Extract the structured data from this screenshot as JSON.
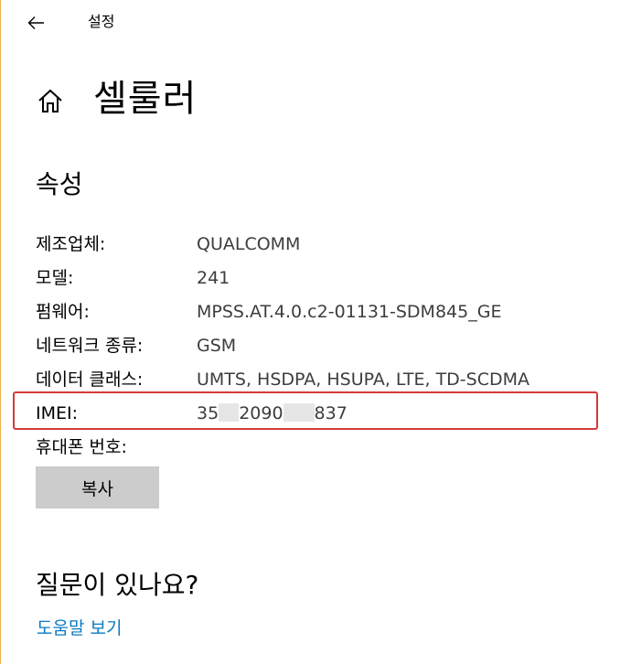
{
  "window": {
    "title": "설정",
    "back_icon": "arrow-left-icon"
  },
  "page": {
    "home_icon": "home-icon",
    "title": "셀룰러"
  },
  "properties": {
    "section_title": "속성",
    "items": [
      {
        "label": "제조업체:",
        "value": "QUALCOMM"
      },
      {
        "label": "모델:",
        "value": "241"
      },
      {
        "label": "펌웨어:",
        "value": "MPSS.AT.4.0.c2-01131-SDM845_GE"
      },
      {
        "label": "네트워크 종류:",
        "value": "GSM"
      },
      {
        "label": "데이터 클래스:",
        "value": "UMTS, HSDPA, HSUPA, LTE, TD-SCDMA"
      },
      {
        "label": "IMEI:",
        "value_parts": [
          "35",
          "2090",
          "837"
        ]
      },
      {
        "label": "휴대폰 번호:",
        "value": ""
      }
    ],
    "copy_button": "복사"
  },
  "help": {
    "title": "질문이 있나요?",
    "link": "도움말 보기"
  },
  "colors": {
    "link": "#0a7ac2",
    "highlight_border": "#d23a3a",
    "button_bg": "#cccccc",
    "window_edge": "#e8b04a"
  }
}
